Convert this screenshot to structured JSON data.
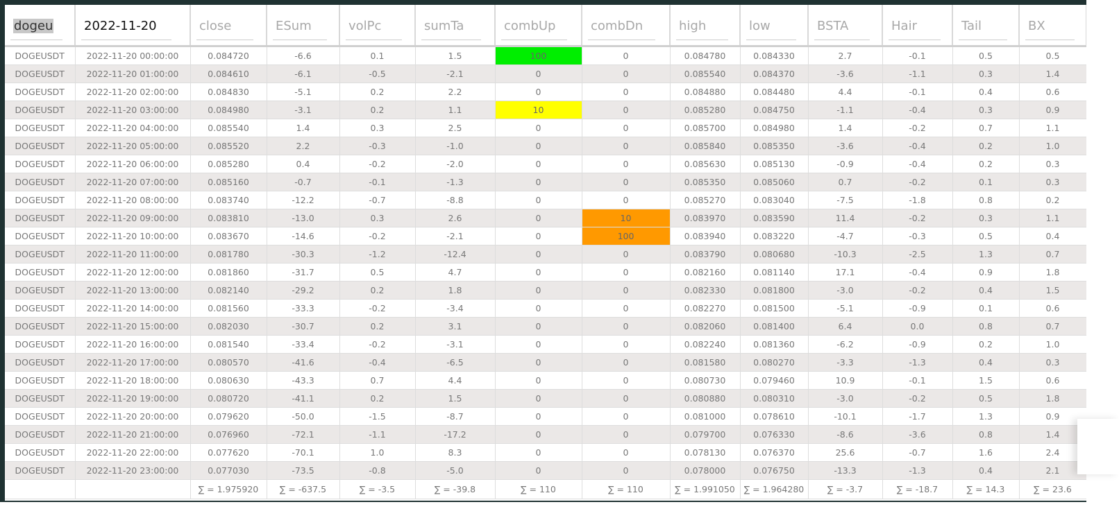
{
  "header": {
    "symbol_filter": "dogeu",
    "date_filter": "2022-11-20",
    "columns": [
      "close",
      "ESum",
      "volPc",
      "sumTa",
      "combUp",
      "combDn",
      "high",
      "low",
      "BSTA",
      "Hair",
      "Tail",
      "BX"
    ]
  },
  "highlight_colors": {
    "green": "#00ee00",
    "yellow": "#ffff00",
    "orange": "#ff9900"
  },
  "rows": [
    [
      "DOGEUSDT",
      "2022-11-20 00:00:00",
      "0.084720",
      "-6.6",
      "0.1",
      "1.5",
      "100",
      "0",
      "0.084780",
      "0.084330",
      "2.7",
      "-0.1",
      "0.5",
      "0.5"
    ],
    [
      "DOGEUSDT",
      "2022-11-20 01:00:00",
      "0.084610",
      "-6.1",
      "-0.5",
      "-2.1",
      "0",
      "0",
      "0.085540",
      "0.084370",
      "-3.6",
      "-1.1",
      "0.3",
      "1.4"
    ],
    [
      "DOGEUSDT",
      "2022-11-20 02:00:00",
      "0.084830",
      "-5.1",
      "0.2",
      "2.2",
      "0",
      "0",
      "0.084880",
      "0.084480",
      "4.4",
      "-0.1",
      "0.4",
      "0.6"
    ],
    [
      "DOGEUSDT",
      "2022-11-20 03:00:00",
      "0.084980",
      "-3.1",
      "0.2",
      "1.1",
      "10",
      "0",
      "0.085280",
      "0.084750",
      "-1.1",
      "-0.4",
      "0.3",
      "0.9"
    ],
    [
      "DOGEUSDT",
      "2022-11-20 04:00:00",
      "0.085540",
      "1.4",
      "0.3",
      "2.5",
      "0",
      "0",
      "0.085700",
      "0.084980",
      "1.4",
      "-0.2",
      "0.7",
      "1.1"
    ],
    [
      "DOGEUSDT",
      "2022-11-20 05:00:00",
      "0.085520",
      "2.2",
      "-0.3",
      "-1.0",
      "0",
      "0",
      "0.085840",
      "0.085350",
      "-3.6",
      "-0.4",
      "0.2",
      "1.0"
    ],
    [
      "DOGEUSDT",
      "2022-11-20 06:00:00",
      "0.085280",
      "0.4",
      "-0.2",
      "-2.0",
      "0",
      "0",
      "0.085630",
      "0.085130",
      "-0.9",
      "-0.4",
      "0.2",
      "0.3"
    ],
    [
      "DOGEUSDT",
      "2022-11-20 07:00:00",
      "0.085160",
      "-0.7",
      "-0.1",
      "-1.3",
      "0",
      "0",
      "0.085350",
      "0.085060",
      "0.7",
      "-0.2",
      "0.1",
      "0.3"
    ],
    [
      "DOGEUSDT",
      "2022-11-20 08:00:00",
      "0.083740",
      "-12.2",
      "-0.7",
      "-8.8",
      "0",
      "0",
      "0.085270",
      "0.083040",
      "-7.5",
      "-1.8",
      "0.8",
      "0.2"
    ],
    [
      "DOGEUSDT",
      "2022-11-20 09:00:00",
      "0.083810",
      "-13.0",
      "0.3",
      "2.6",
      "0",
      "10",
      "0.083970",
      "0.083590",
      "11.4",
      "-0.2",
      "0.3",
      "1.1"
    ],
    [
      "DOGEUSDT",
      "2022-11-20 10:00:00",
      "0.083670",
      "-14.6",
      "-0.2",
      "-2.1",
      "0",
      "100",
      "0.083940",
      "0.083220",
      "-4.7",
      "-0.3",
      "0.5",
      "0.4"
    ],
    [
      "DOGEUSDT",
      "2022-11-20 11:00:00",
      "0.081780",
      "-30.3",
      "-1.2",
      "-12.4",
      "0",
      "0",
      "0.083790",
      "0.080680",
      "-10.3",
      "-2.5",
      "1.3",
      "0.7"
    ],
    [
      "DOGEUSDT",
      "2022-11-20 12:00:00",
      "0.081860",
      "-31.7",
      "0.5",
      "4.7",
      "0",
      "0",
      "0.082160",
      "0.081140",
      "17.1",
      "-0.4",
      "0.9",
      "1.8"
    ],
    [
      "DOGEUSDT",
      "2022-11-20 13:00:00",
      "0.082140",
      "-29.2",
      "0.2",
      "1.8",
      "0",
      "0",
      "0.082330",
      "0.081800",
      "-3.0",
      "-0.2",
      "0.4",
      "1.5"
    ],
    [
      "DOGEUSDT",
      "2022-11-20 14:00:00",
      "0.081560",
      "-33.3",
      "-0.2",
      "-3.4",
      "0",
      "0",
      "0.082270",
      "0.081500",
      "-5.1",
      "-0.9",
      "0.1",
      "0.6"
    ],
    [
      "DOGEUSDT",
      "2022-11-20 15:00:00",
      "0.082030",
      "-30.7",
      "0.2",
      "3.1",
      "0",
      "0",
      "0.082060",
      "0.081400",
      "6.4",
      "0.0",
      "0.8",
      "0.7"
    ],
    [
      "DOGEUSDT",
      "2022-11-20 16:00:00",
      "0.081540",
      "-33.4",
      "-0.2",
      "-3.1",
      "0",
      "0",
      "0.082240",
      "0.081360",
      "-6.2",
      "-0.9",
      "0.2",
      "1.0"
    ],
    [
      "DOGEUSDT",
      "2022-11-20 17:00:00",
      "0.080570",
      "-41.6",
      "-0.4",
      "-6.5",
      "0",
      "0",
      "0.081580",
      "0.080270",
      "-3.3",
      "-1.3",
      "0.4",
      "0.3"
    ],
    [
      "DOGEUSDT",
      "2022-11-20 18:00:00",
      "0.080630",
      "-43.3",
      "0.7",
      "4.4",
      "0",
      "0",
      "0.080730",
      "0.079460",
      "10.9",
      "-0.1",
      "1.5",
      "0.6"
    ],
    [
      "DOGEUSDT",
      "2022-11-20 19:00:00",
      "0.080720",
      "-41.1",
      "0.2",
      "1.5",
      "0",
      "0",
      "0.080880",
      "0.080310",
      "-3.0",
      "-0.2",
      "0.5",
      "1.8"
    ],
    [
      "DOGEUSDT",
      "2022-11-20 20:00:00",
      "0.079620",
      "-50.0",
      "-1.5",
      "-8.7",
      "0",
      "0",
      "0.081000",
      "0.078610",
      "-10.1",
      "-1.7",
      "1.3",
      "0.9"
    ],
    [
      "DOGEUSDT",
      "2022-11-20 21:00:00",
      "0.076960",
      "-72.1",
      "-1.1",
      "-17.2",
      "0",
      "0",
      "0.079700",
      "0.076330",
      "-8.6",
      "-3.6",
      "0.8",
      "1.4"
    ],
    [
      "DOGEUSDT",
      "2022-11-20 22:00:00",
      "0.077620",
      "-70.1",
      "1.0",
      "8.3",
      "0",
      "0",
      "0.078130",
      "0.076370",
      "25.6",
      "-0.7",
      "1.6",
      "2.4"
    ],
    [
      "DOGEUSDT",
      "2022-11-20 23:00:00",
      "0.077030",
      "-73.5",
      "-0.8",
      "-5.0",
      "0",
      "0",
      "0.078000",
      "0.076750",
      "-13.3",
      "-1.3",
      "0.4",
      "2.1"
    ]
  ],
  "highlights": {
    "0-6": "green",
    "3-6": "yellow",
    "9-7": "orange",
    "10-7": "orange"
  },
  "sums": [
    "",
    "",
    "∑ = 1.975920",
    "∑ = -637.5",
    "∑ = -3.5",
    "∑ = -39.8",
    "∑ = 110",
    "∑ = 110",
    "∑ = 1.991050",
    "∑ = 1.964280",
    "∑ = -3.7",
    "∑ = -18.7",
    "∑ = 14.3",
    "∑ = 23.6"
  ]
}
